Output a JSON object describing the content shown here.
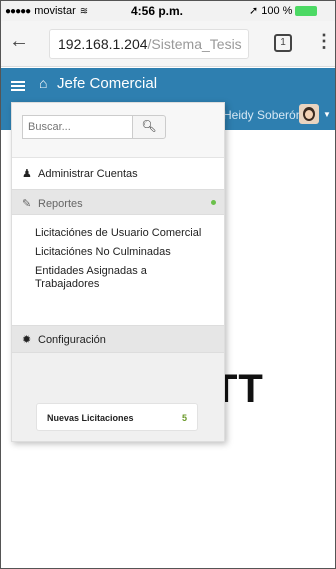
{
  "status_bar": {
    "carrier": "movistar",
    "time": "4:56 p.m.",
    "battery": "100 %",
    "signal_icon": "signal-dots",
    "wifi_icon": "wifi-icon",
    "location_icon": "location-arrow-icon"
  },
  "browser": {
    "url_host": "192.168.1.204",
    "url_path": "/Sistema_Tesis",
    "tab_count": "1",
    "back_icon": "back-arrow-icon",
    "menu_icon": "kebab-menu-icon"
  },
  "app": {
    "title": "Jefe Comercial",
    "user_name": "Heidy Soberón",
    "nav_color": "#2e7fb0",
    "big_text": "TT"
  },
  "side_menu": {
    "search_placeholder": "Buscar...",
    "items": {
      "admin": "Administrar Cuentas",
      "reportes": "Reportes",
      "config": "Configuración"
    },
    "reportes_sub": [
      "Licitaciónes de Usuario Comercial",
      "Licitaciónes No Culminadas",
      "Entidades Asignadas a Trabajadores"
    ],
    "news": {
      "label": "Nuevas Licitaciones",
      "count": "5"
    },
    "active_dot_color": "#6bc04b"
  }
}
